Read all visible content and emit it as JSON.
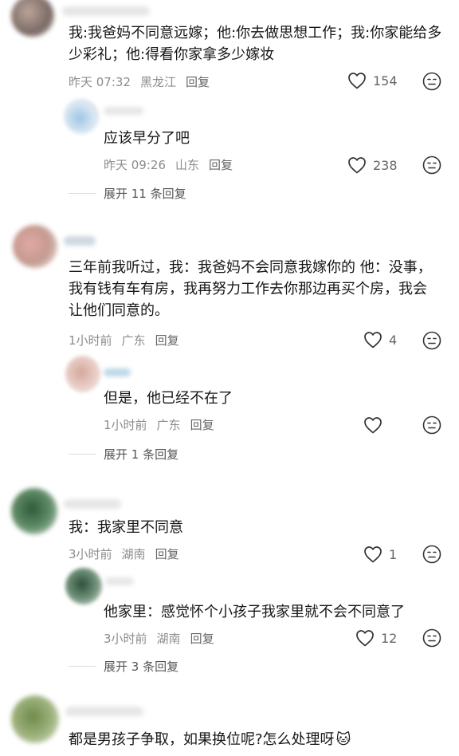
{
  "comments": [
    {
      "text": "我:我爸妈不同意远嫁；他:你去做思想工作；我:你家能给多少彩礼；他:得看你家拿多少嫁妆",
      "time": "昨天 07:32",
      "location": "黑龙江",
      "reply_label": "回复",
      "likes": "154",
      "replies": [
        {
          "text": "应该早分了吧",
          "time": "昨天 09:26",
          "location": "山东",
          "reply_label": "回复",
          "likes": "238"
        }
      ],
      "expand_label": "展开 11 条回复"
    },
    {
      "text": "三年前我听过，我：我爸妈不会同意我嫁你的 他：没事，我有钱有车有房，我再努力工作去你那边再买个房，我会让他们同意的。",
      "time": "1小时前",
      "location": "广东",
      "reply_label": "回复",
      "likes": "4",
      "replies": [
        {
          "text": "但是，他已经不在了",
          "time": "1小时前",
          "location": "广东",
          "reply_label": "回复",
          "likes": ""
        }
      ],
      "expand_label": "展开 1 条回复"
    },
    {
      "text": "我：我家里不同意",
      "time": "3小时前",
      "location": "湖南",
      "reply_label": "回复",
      "likes": "1",
      "replies": [
        {
          "text": "他家里：感觉怀个小孩子我家里就不会不同意了",
          "time": "3小时前",
          "location": "湖南",
          "reply_label": "回复",
          "likes": "12"
        }
      ],
      "expand_label": "展开 3 条回复"
    },
    {
      "text": "都是男孩子争取，如果换位呢?怎么处理呀",
      "emoji": "🐱"
    }
  ]
}
